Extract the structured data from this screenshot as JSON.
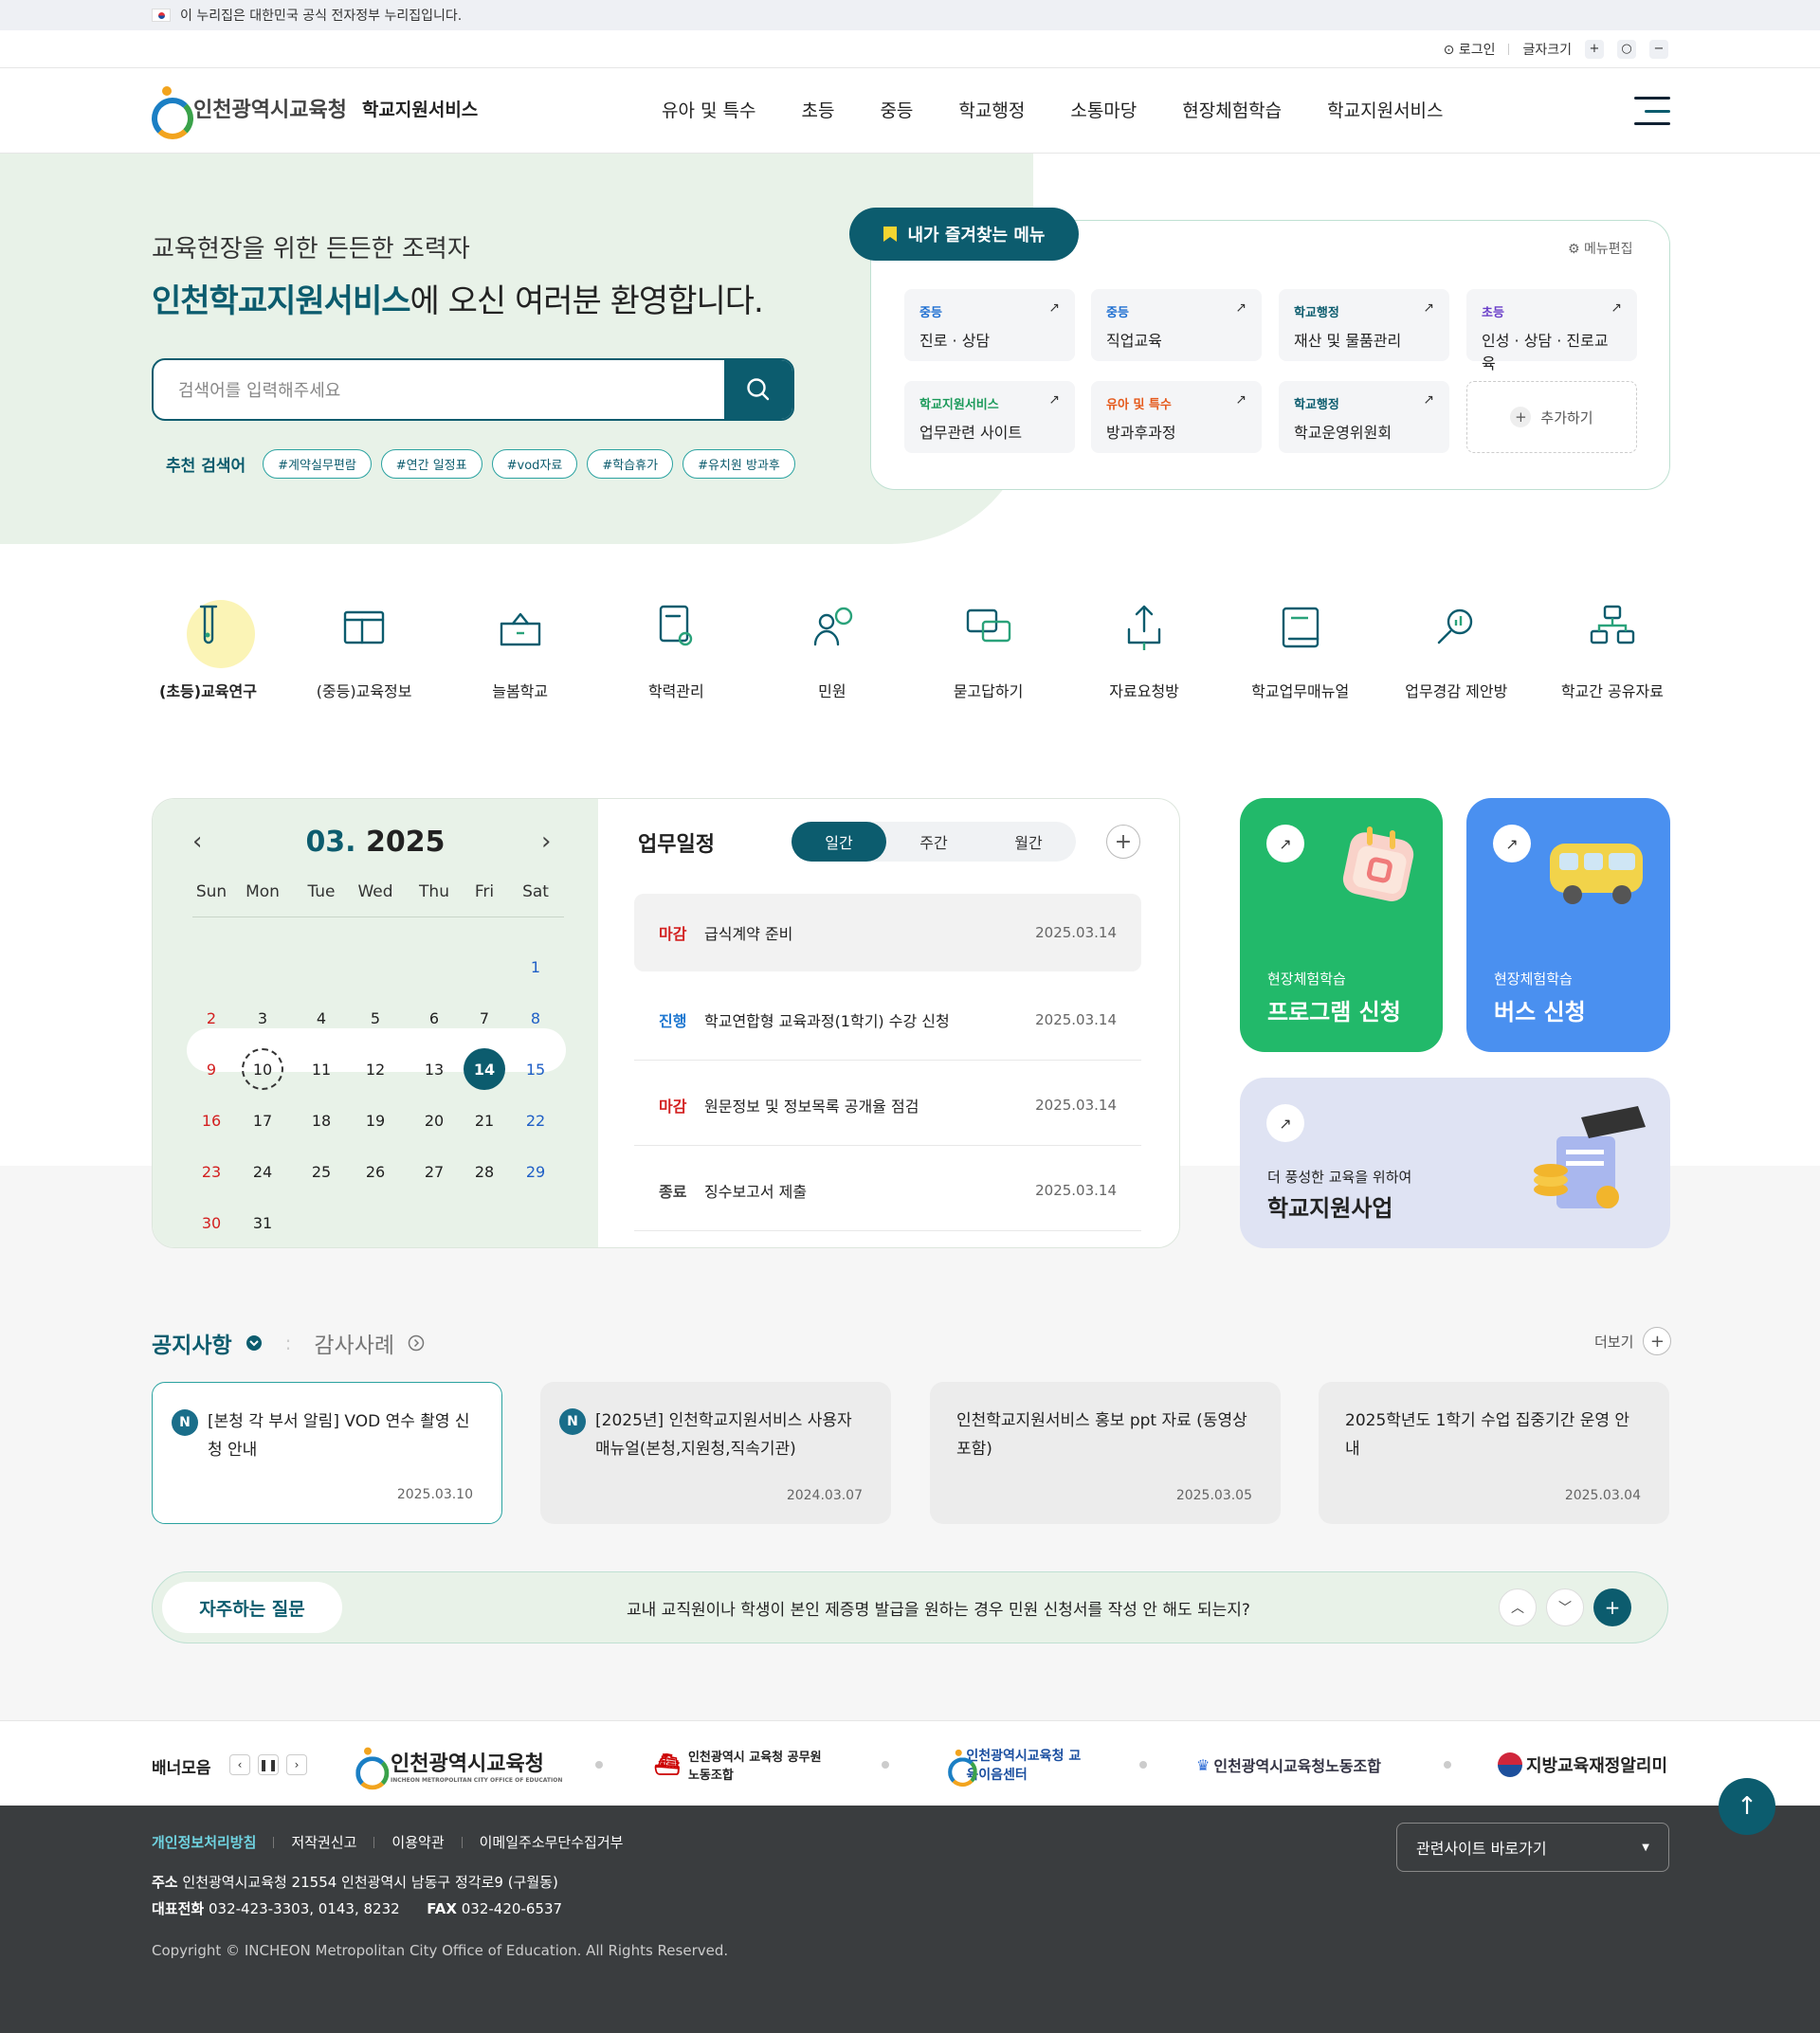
{
  "gov_notice": "이 누리집은 대한민국 공식 전자정부 누리집입니다.",
  "util": {
    "login": "로그인",
    "font_size": "글자크기",
    "plus": "+",
    "reset": "○",
    "minus": "−"
  },
  "header": {
    "org": "인천광역시교육청",
    "service": "학교지원서비스",
    "menu": [
      "유아 및 특수",
      "초등",
      "중등",
      "학교행정",
      "소통마당",
      "현장체험학습",
      "학교지원서비스"
    ]
  },
  "hero": {
    "line1": "교육현장을 위한 든든한 조력자",
    "line2_bold": "인천학교지원서비스",
    "line2_rest": "에 오신 여러분 환영합니다.",
    "search_placeholder": "검색어를 입력해주세요",
    "rec_label": "추천 검색어",
    "tags": [
      "#계약실무편람",
      "#연간 일정표",
      "#vod자료",
      "#학습휴가",
      "#유치원 방과후"
    ]
  },
  "fav": {
    "tab": "내가 즐겨찾는 메뉴",
    "edit": "메뉴편집",
    "add": "추가하기",
    "items": [
      {
        "cat": "중등",
        "name": "진로 · 상담",
        "color": "#1f6fd1"
      },
      {
        "cat": "중등",
        "name": "직업교육",
        "color": "#1f6fd1"
      },
      {
        "cat": "학교행정",
        "name": "재산 및 물품관리",
        "color": "#0c5c6e"
      },
      {
        "cat": "초등",
        "name": "인성 · 상담 · 진로교육",
        "color": "#6a3fc9"
      },
      {
        "cat": "학교지원서비스",
        "name": "업무관련 사이트",
        "color": "#1b9a5a"
      },
      {
        "cat": "유아 및 특수",
        "name": "방과후과정",
        "color": "#e55a1c"
      },
      {
        "cat": "학교행정",
        "name": "학교운영위원회",
        "color": "#0c5c6e"
      }
    ]
  },
  "quick": [
    "(초등)교육연구",
    "(중등)교육정보",
    "늘봄학교",
    "학력관리",
    "민원",
    "묻고답하기",
    "자료요청방",
    "학교업무매뉴얼",
    "업무경감 제안방",
    "학교간 공유자료"
  ],
  "calendar": {
    "month": "03.",
    "year": "2025",
    "dow": [
      "Sun",
      "Mon",
      "Tue",
      "Wed",
      "Thu",
      "Fri",
      "Sat"
    ],
    "weeks": [
      [
        "",
        "",
        "",
        "",
        "",
        "",
        "1"
      ],
      [
        "2",
        "3",
        "4",
        "5",
        "6",
        "7",
        "8"
      ],
      [
        "9",
        "10",
        "11",
        "12",
        "13",
        "14",
        "15"
      ],
      [
        "16",
        "17",
        "18",
        "19",
        "20",
        "21",
        "22"
      ],
      [
        "23",
        "24",
        "25",
        "26",
        "27",
        "28",
        "29"
      ],
      [
        "30",
        "31",
        "",
        "",
        "",
        "",
        ""
      ]
    ]
  },
  "schedule": {
    "title": "업무일정",
    "tabs": [
      "일간",
      "주간",
      "월간"
    ],
    "rows": [
      {
        "status": "마감",
        "title": "급식계약 준비",
        "date": "2025.03.14",
        "color": "#d32020"
      },
      {
        "status": "진행",
        "title": "학교연합형 교육과정(1학기) 수강 신청",
        "date": "2025.03.14",
        "color": "#1f78d1"
      },
      {
        "status": "마감",
        "title": "원문정보 및 정보목록 공개율 점검",
        "date": "2025.03.14",
        "color": "#d32020"
      },
      {
        "status": "종료",
        "title": "징수보고서 제출",
        "date": "2025.03.14",
        "color": "#444"
      }
    ]
  },
  "banners": [
    {
      "sub": "현장체험학습",
      "title": "프로그램 신청"
    },
    {
      "sub": "현장체험학습",
      "title": "버스 신청"
    },
    {
      "sub": "더 풍성한 교육을 위하여",
      "title": "학교지원사업"
    }
  ],
  "notice": {
    "tab1": "공지사항",
    "tab2": "감사사례",
    "more": "더보기",
    "items": [
      {
        "badge": "N",
        "text": "[본청 각 부서 알림] VOD 연수 촬영 신청 안내",
        "date": "2025.03.10"
      },
      {
        "badge": "N",
        "text": "[2025년] 인천학교지원서비스 사용자 매뉴얼(본청,지원청,직속기관)",
        "date": "2024.03.07"
      },
      {
        "badge": "",
        "text": "인천학교지원서비스 홍보 ppt 자료 (동영상 포함)",
        "date": "2025.03.05"
      },
      {
        "badge": "",
        "text": "2025학년도 1학기 수업 집중기간 운영 안내",
        "date": "2025.03.04"
      }
    ]
  },
  "faq": {
    "label": "자주하는 질문",
    "question": "교내 교직원이나 학생이 본인 제증명 발급을 원하는 경우 민원 신청서를 작성 안 해도 되는지?"
  },
  "banner_row": {
    "label": "배너모음",
    "logos": [
      "인천광역시교육청",
      "인천광역시 교육청 공무원노동조합",
      "인천광역시교육청 교육이음센터",
      "인천광역시교육청노동조합",
      "지방교육재정알리미"
    ],
    "logo_sub": "INCHEON METROPOLITAN CITY OFFICE OF EDUCATION"
  },
  "footer": {
    "links": [
      "개인정보처리방침",
      "저작권신고",
      "이용약관",
      "이메일주소무단수집거부"
    ],
    "addr_label": "주소",
    "addr": "인천광역시교육청 21554 인천광역시 남동구 정각로9 (구월동)",
    "tel_label": "대표전화",
    "tel": "032-423-3303, 0143, 8232",
    "fax_label": "FAX",
    "fax": "032-420-6537",
    "copyright": "Copyright © INCHEON Metropolitan City Office of Education. All Rights Reserved.",
    "related": "관련사이트 바로가기"
  }
}
